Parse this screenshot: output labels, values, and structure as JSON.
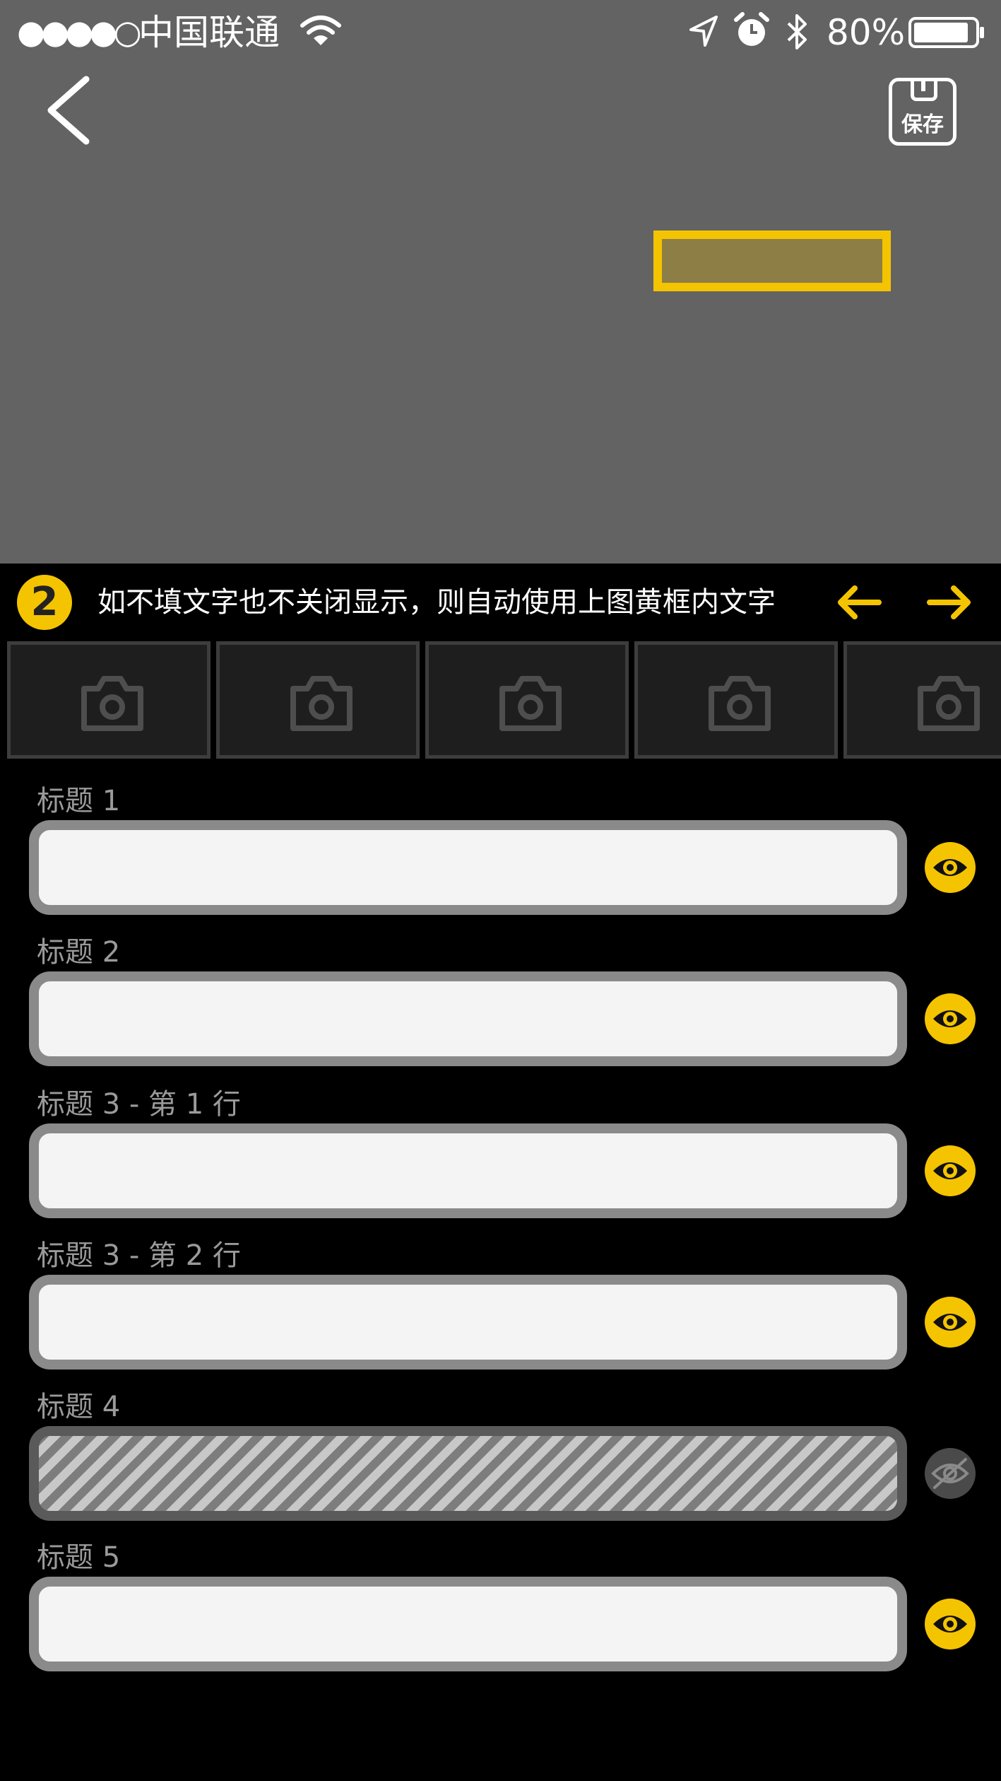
{
  "status_bar": {
    "signal": "●●●●○",
    "carrier": "中国联通",
    "battery": "80%"
  },
  "header": {
    "back_icon": "chevron-left-icon",
    "save_label": "保存",
    "save_icon": "floppy-disk-icon"
  },
  "instruction": {
    "step": "2",
    "text": "如不填文字也不关闭显示，则自动使用上图黄框内文字",
    "prev_icon": "arrow-left-icon",
    "next_icon": "arrow-right-icon"
  },
  "thumbnails": {
    "icon": "camera-icon",
    "count": 5
  },
  "fields": [
    {
      "label": "标题 1",
      "value": "",
      "visible": true
    },
    {
      "label": "标题 2",
      "value": "",
      "visible": true
    },
    {
      "label": "标题 3 - 第 1 行",
      "value": "",
      "visible": true
    },
    {
      "label": "标题 3 - 第 2 行",
      "value": "",
      "visible": true
    },
    {
      "label": "标题 4",
      "value": "",
      "visible": false
    },
    {
      "label": "标题 5",
      "value": "",
      "visible": true
    }
  ],
  "colors": {
    "accent": "#f5c400",
    "preview_background": "#636363",
    "background": "#000000",
    "field_border": "#8a8a8a",
    "field_fill": "#f4f4f4",
    "thumbnail_fill": "#1e1e1e"
  }
}
